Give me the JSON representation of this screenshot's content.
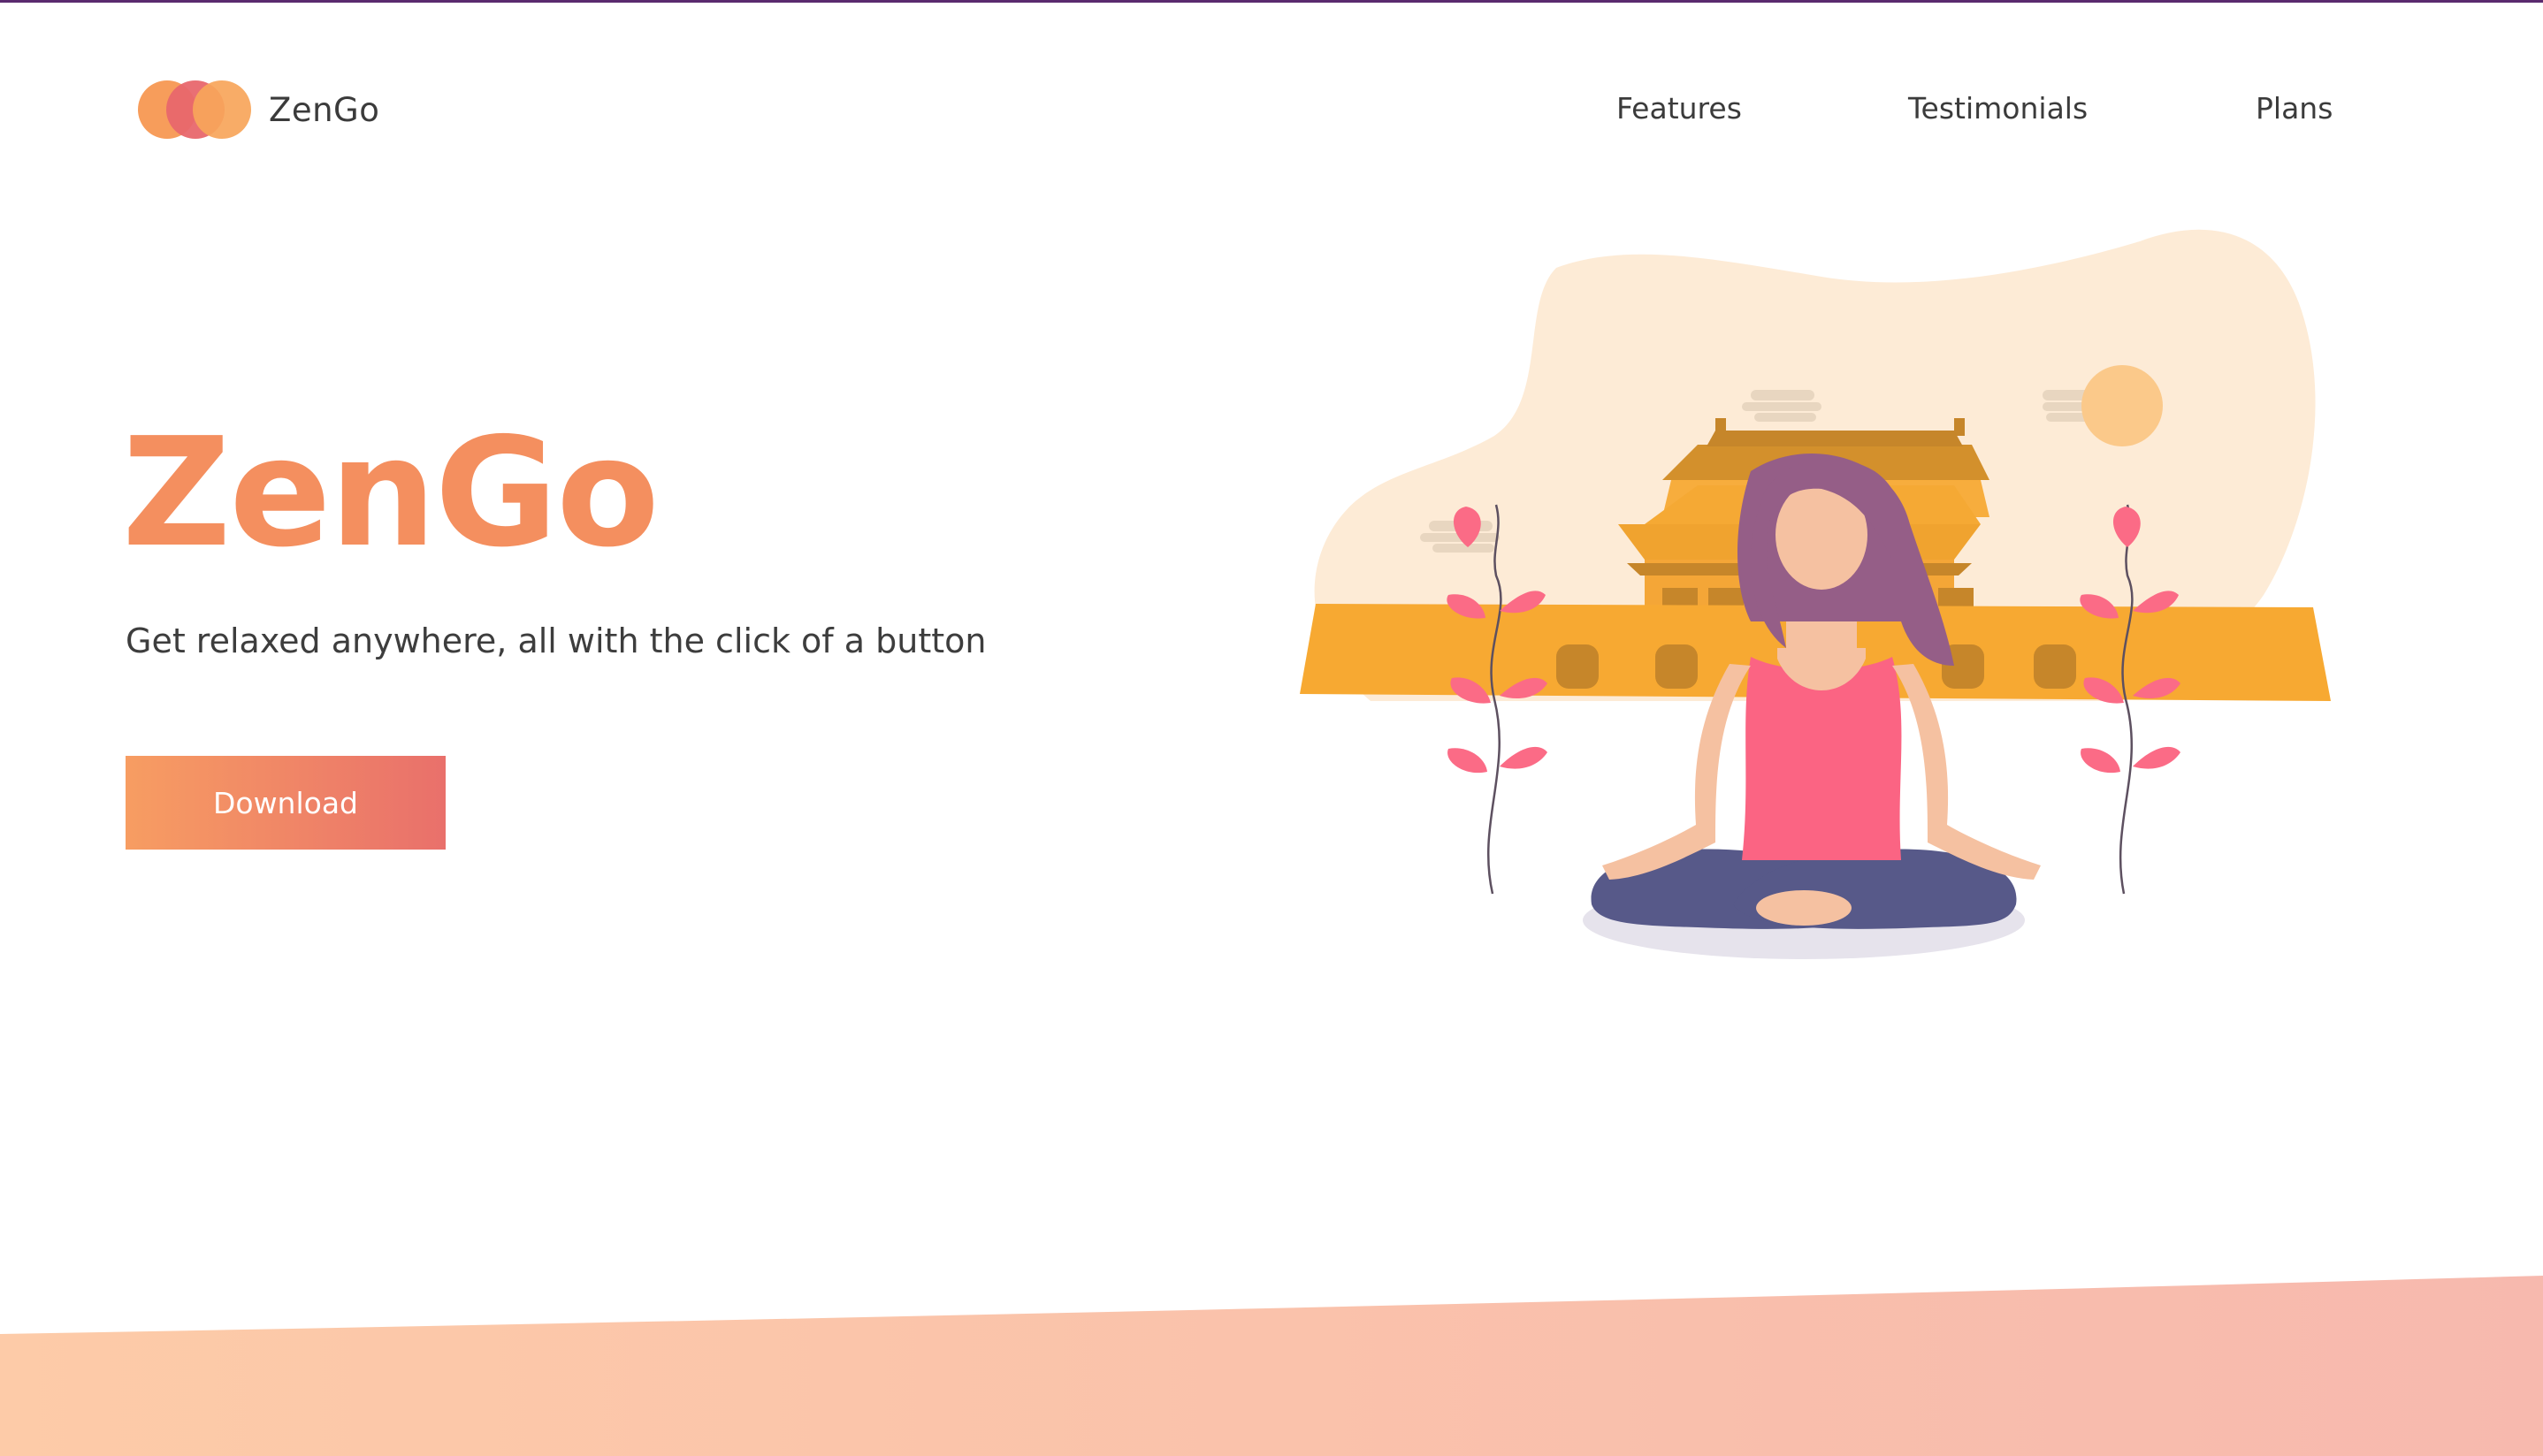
{
  "brand": {
    "name": "ZenGo",
    "logo_icon": "three-overlapping-circles-logo-icon"
  },
  "nav": {
    "items": [
      {
        "label": "Features"
      },
      {
        "label": "Testimonials"
      },
      {
        "label": "Plans"
      }
    ]
  },
  "hero": {
    "title": "ZenGo",
    "subtitle": "Get relaxed anywhere, all with the click of a button",
    "download_label": "Download"
  },
  "colors": {
    "accent": "#f48f5f",
    "button_start": "#f79d62",
    "button_end": "#e9706b",
    "top_border": "#5a2a6e",
    "footer_start": "#fdcba8",
    "footer_end": "#f7b9ae"
  }
}
